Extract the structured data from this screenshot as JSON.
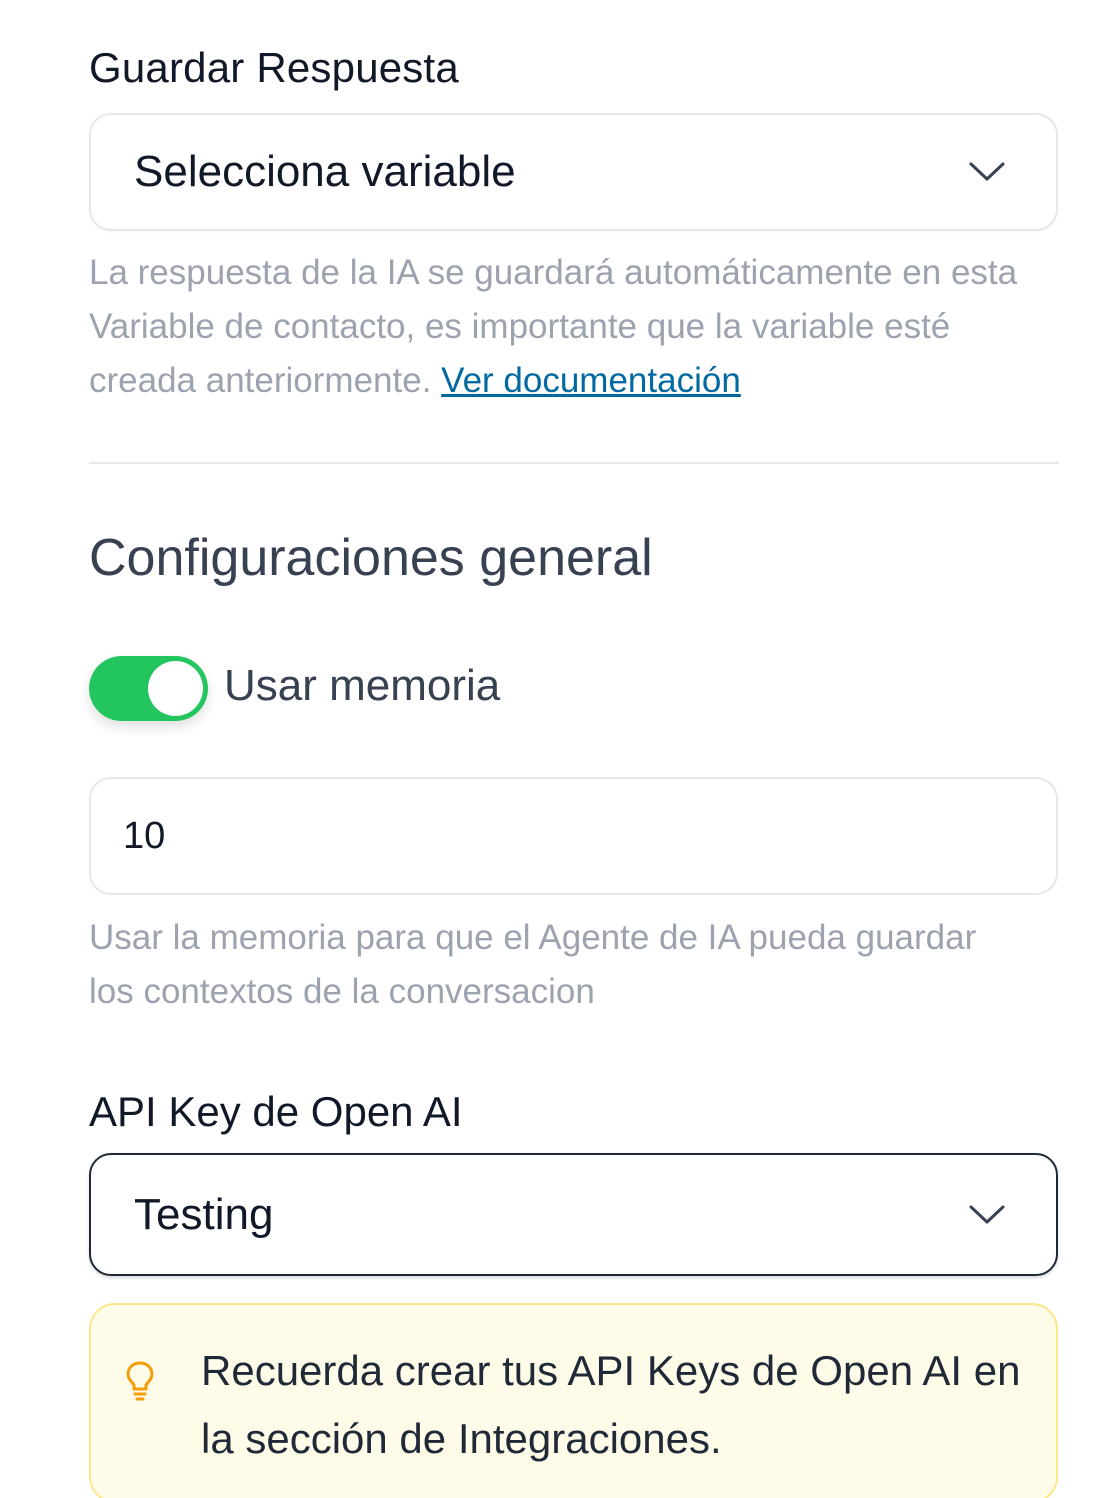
{
  "save_response": {
    "label": "Guardar Respuesta",
    "select_value": "Selecciona variable",
    "help_text": "La respuesta de la IA se guardará automáticamente en esta Variable de contacto, es importante que la variable esté creada anteriormente.",
    "help_link": "Ver documentación"
  },
  "general": {
    "title": "Configuraciones general",
    "memory_toggle_label": "Usar memoria",
    "memory_toggle_on": true,
    "memory_value": "10",
    "memory_help": "Usar la memoria para que el Agente de IA pueda guardar los contextos de la conversacion"
  },
  "api_key": {
    "label": "API Key de Open AI",
    "select_value": "Testing"
  },
  "callout": {
    "icon": "lightbulb-icon",
    "text": "Recuerda crear tus API Keys de Open AI en la sección de Integraciones."
  },
  "colors": {
    "toggle_on": "#22c55e",
    "link": "#0369a1",
    "callout_bg": "#fefce8",
    "callout_border": "#fde68a",
    "bulb": "#f59e0b"
  }
}
